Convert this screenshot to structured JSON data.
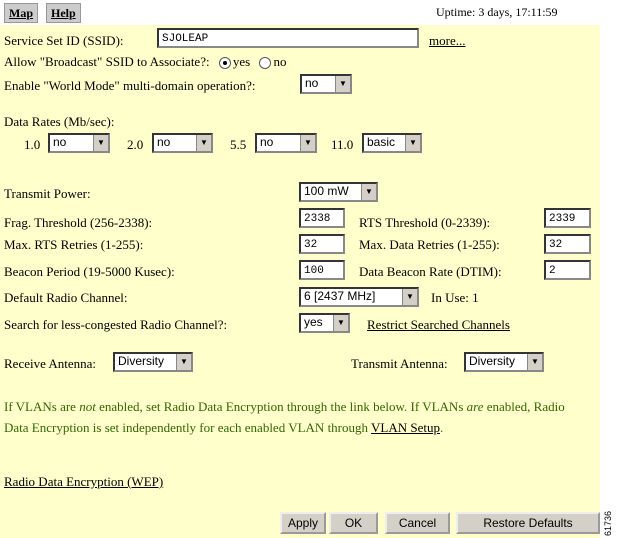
{
  "nav": {
    "map": "Map",
    "help": "Help"
  },
  "uptime": "Uptime: 3 days, 17:11:59",
  "ssid": {
    "label": "Service Set ID (SSID):",
    "value": "SJOLEAP",
    "more": "more..."
  },
  "broadcast": {
    "label": "Allow \"Broadcast\" SSID to Associate?:",
    "yes": "yes",
    "no": "no",
    "selected": "yes"
  },
  "world_mode": {
    "label": "Enable \"World Mode\" multi-domain operation?:",
    "value": "no"
  },
  "data_rates": {
    "label": "Data Rates  (Mb/sec):",
    "rates": [
      {
        "rate": "1.0",
        "value": "no"
      },
      {
        "rate": "2.0",
        "value": "no"
      },
      {
        "rate": "5.5",
        "value": "no"
      },
      {
        "rate": "11.0",
        "value": "basic"
      }
    ]
  },
  "transmit_power": {
    "label": "Transmit Power:",
    "value": "100 mW"
  },
  "frag": {
    "label": "Frag. Threshold (256-2338):",
    "value": "2338"
  },
  "rts_threshold": {
    "label": "RTS Threshold (0-2339):",
    "value": "2339"
  },
  "max_rts": {
    "label": "Max. RTS Retries (1-255):",
    "value": "32"
  },
  "max_data": {
    "label": "Max. Data Retries (1-255):",
    "value": "32"
  },
  "beacon_period": {
    "label": "Beacon Period (19-5000 Kusec):",
    "value": "100"
  },
  "dtim": {
    "label": "Data Beacon Rate (DTIM):",
    "value": "2"
  },
  "channel": {
    "label": "Default Radio Channel:",
    "value": "6  [2437 MHz]",
    "in_use": "In Use: 1"
  },
  "search": {
    "label": "Search for less-congested Radio Channel?:",
    "value": "yes",
    "restrict": "Restrict Searched Channels"
  },
  "receive_antenna": {
    "label": "Receive Antenna:",
    "value": "Diversity"
  },
  "transmit_antenna": {
    "label": "Transmit Antenna:",
    "value": "Diversity"
  },
  "message": {
    "p1": "If VLANs are ",
    "not": "not",
    "p2": " enabled, set Radio Data Encryption through the link below. If VLANs ",
    "are": "are",
    "p3": " enabled, Radio Data Encryption is set independently for each enabled VLAN through ",
    "vlan_link": "VLAN Setup",
    "p4": "."
  },
  "wep_link": "Radio Data Encryption (WEP)",
  "buttons": {
    "apply": "Apply",
    "ok": "OK",
    "cancel": "Cancel",
    "restore": "Restore Defaults"
  },
  "figure_number": "61736",
  "colors": {
    "panel": "#ffffcc",
    "message": "#336600",
    "button": "#d4d0c8"
  }
}
